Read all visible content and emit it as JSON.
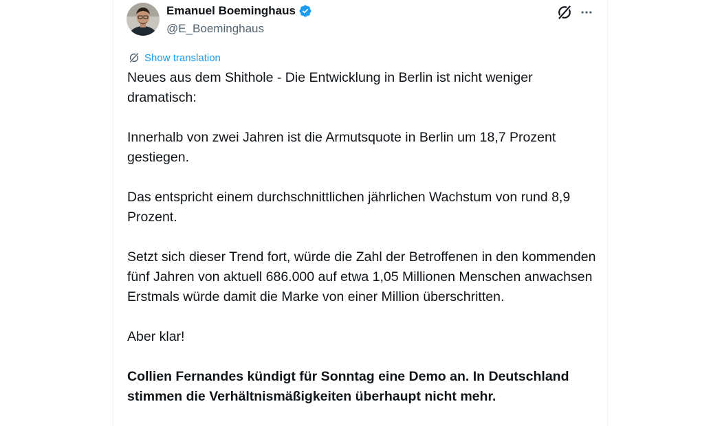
{
  "author": {
    "name": "Emanuel Boeminghaus",
    "handle": "@E_Boeminghaus"
  },
  "icons": {
    "avatar": "avatar",
    "verified": "verified-badge-icon",
    "grok": "grok-icon",
    "more": "more-dots-icon",
    "translate": "translate-icon"
  },
  "colors": {
    "accent": "#1d9bf0",
    "text": "#0f1419",
    "secondary": "#536471"
  },
  "translation": {
    "label": "Show translation"
  },
  "tweet": {
    "paragraphs": [
      "Neues aus dem Shithole - Die Entwicklung in Berlin ist nicht weniger dramatisch:",
      "Innerhalb von zwei Jahren ist die Armutsquote in Berlin um 18,7 Prozent gestiegen.",
      "Das entspricht einem durchschnittlichen jährlichen Wachstum von rund 8,9 Prozent.",
      "Setzt sich dieser Trend fort, würde die Zahl der Betroffenen in den kommenden fünf Jahren von aktuell 686.000 auf etwa 1,05 Millionen Menschen anwachsen Erstmals würde damit die Marke von einer Million überschritten.",
      "Aber klar!",
      "Collien Fernandes kündigt für Sonntag eine Demo an. In Deutschland stimmen die Verhältnismäßigkeiten überhaupt nicht mehr."
    ]
  }
}
